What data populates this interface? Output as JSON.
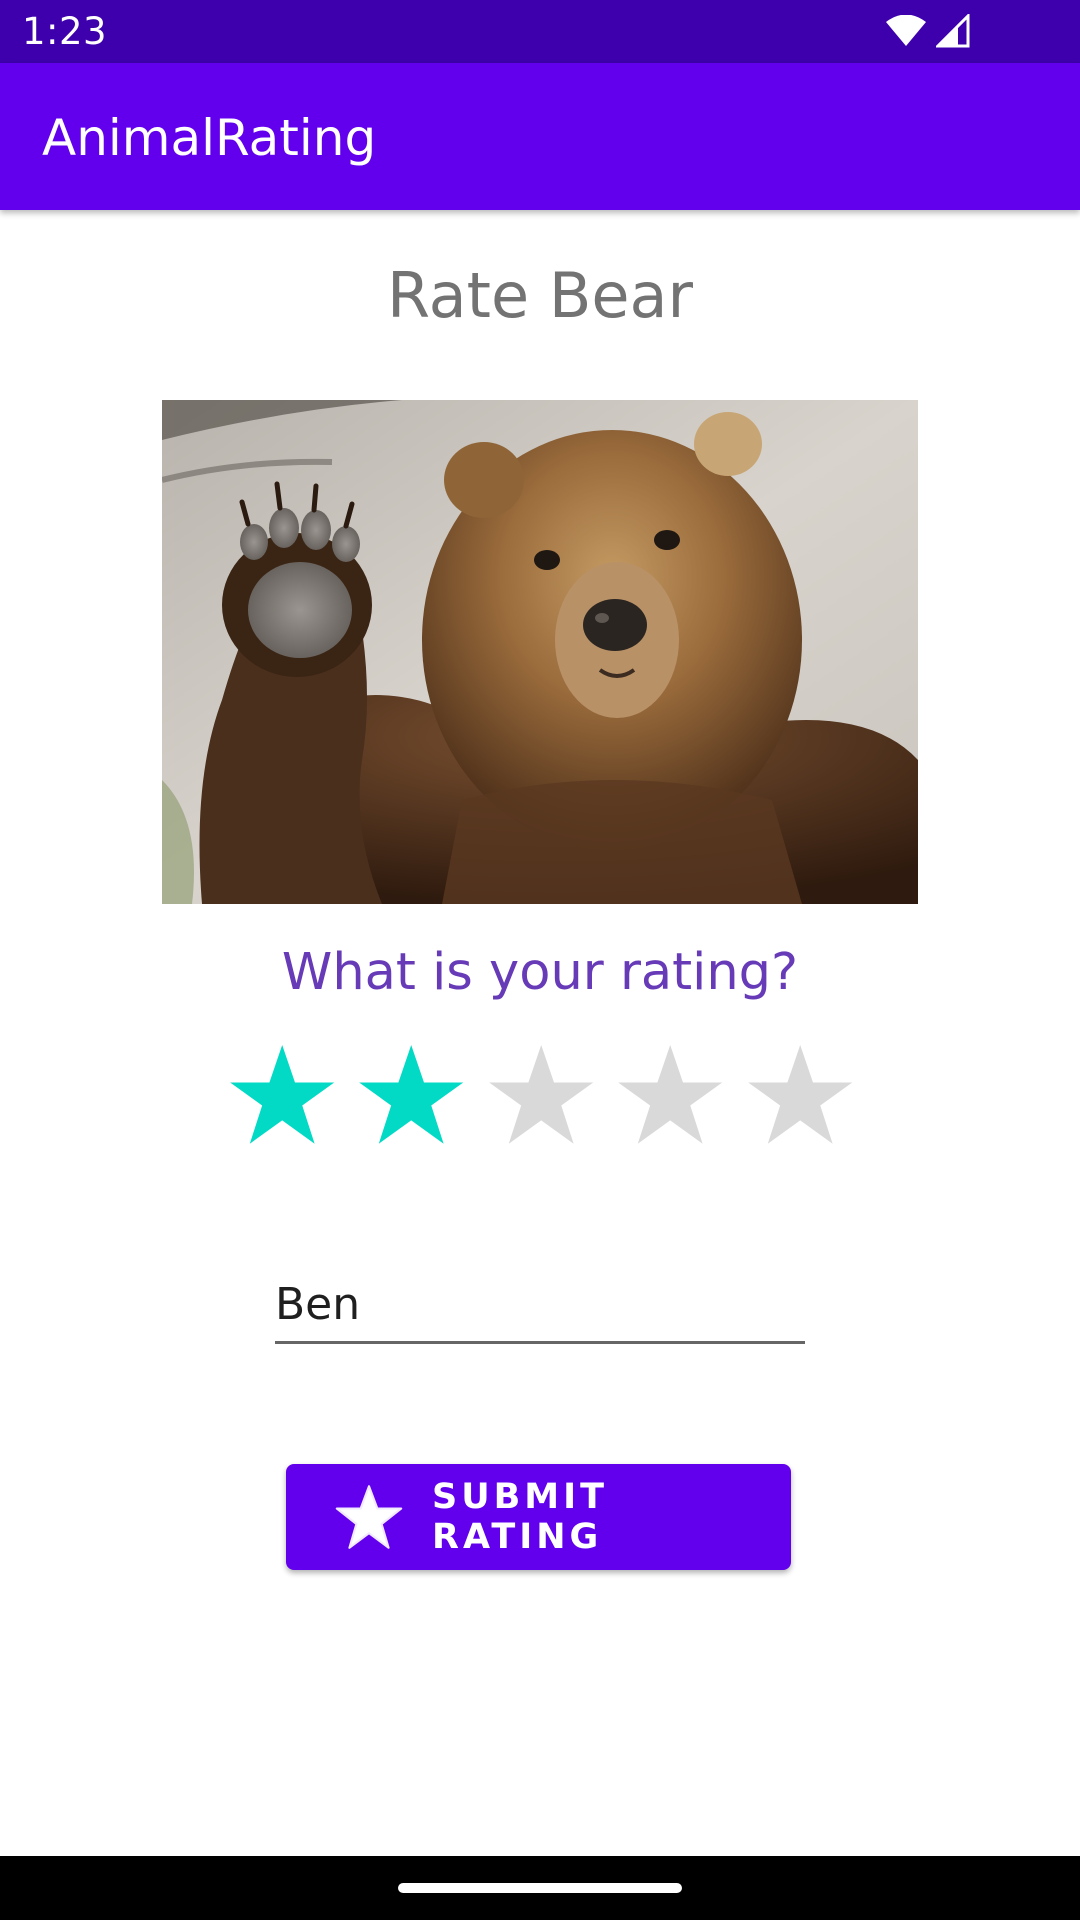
{
  "status_bar": {
    "time": "1:23",
    "icons": [
      "wifi-icon",
      "cellular-signal-icon"
    ]
  },
  "app_bar": {
    "title": "AnimalRating"
  },
  "main": {
    "heading": "Rate Bear",
    "photo": {
      "icon": "bear-photo"
    },
    "question": "What is your rating?",
    "rating": {
      "value": 2,
      "max": 5,
      "filled_color": "#03DAC5",
      "empty_color": "#D9D9D9"
    },
    "name_input": {
      "value": "Ben"
    },
    "submit_button": {
      "label": "SUBMIT RATING",
      "icon": "star-icon"
    }
  },
  "colors": {
    "status_bar": "#3E00AD",
    "primary": "#6200EE",
    "question_text": "#673AB7",
    "heading_text": "#737373"
  }
}
